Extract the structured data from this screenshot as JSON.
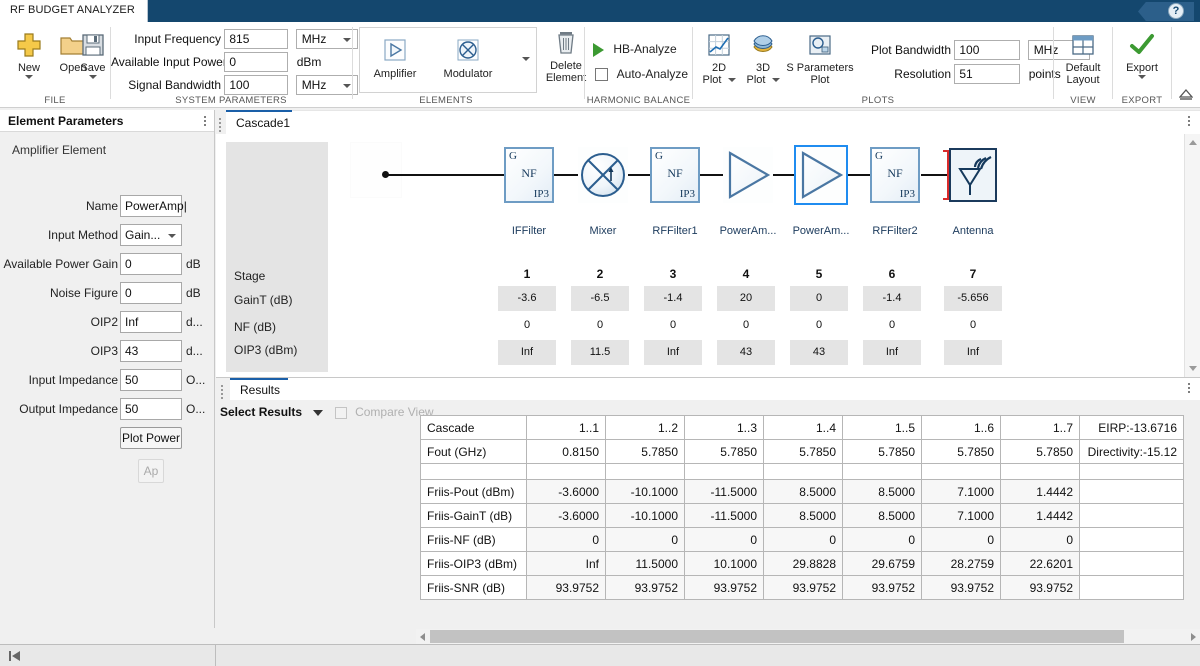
{
  "titlebar": {
    "app_tab": "RF BUDGET ANALYZER",
    "help_icon": "help-question-icon",
    "help_glyph": "?"
  },
  "ribbon": {
    "groups": [
      {
        "id": "file",
        "label": "FILE"
      },
      {
        "id": "system",
        "label": "SYSTEM PARAMETERS"
      },
      {
        "id": "elements",
        "label": "ELEMENTS"
      },
      {
        "id": "harmonic",
        "label": "HARMONIC BALANCE"
      },
      {
        "id": "plots",
        "label": "PLOTS"
      },
      {
        "id": "view",
        "label": "VIEW"
      },
      {
        "id": "export",
        "label": "EXPORT"
      }
    ],
    "file": {
      "new_label": "New",
      "new_icon": "plus-icon",
      "open_label": "Open",
      "open_icon": "folder-icon",
      "save_label": "Save",
      "save_icon": "floppy-disk-icon"
    },
    "system_parameters": {
      "input_frequency_label": "Input Frequency",
      "input_frequency_value": "815",
      "input_frequency_unit": "MHz",
      "available_input_power_label": "Available Input Power",
      "available_input_power_value": "0",
      "available_input_power_unit": "dBm",
      "signal_bandwidth_label": "Signal Bandwidth",
      "signal_bandwidth_value": "100",
      "signal_bandwidth_unit": "MHz"
    },
    "elements": {
      "amplifier_label": "Amplifier",
      "amplifier_icon": "amplifier-triangle-icon",
      "modulator_label": "Modulator",
      "modulator_icon": "modulator-circle-x-icon",
      "more_icon": "chevron-down-icon",
      "delete_element_line1": "Delete",
      "delete_element_line2": "Element",
      "delete_icon": "trash-icon"
    },
    "harmonic_balance": {
      "hb_analyze_label": "HB-Analyze",
      "hb_analyze_icon": "play-triangle-icon",
      "auto_analyze_label": "Auto-Analyze",
      "auto_analyze_checked": false
    },
    "plots": {
      "plot2d_line1": "2D",
      "plot2d_line2": "Plot",
      "plot2d_icon": "line-chart-icon",
      "plot3d_line1": "3D",
      "plot3d_line2": "Plot",
      "plot3d_icon": "surface-3d-icon",
      "sparams_line1": "S Parameters",
      "sparams_line2": "Plot",
      "sparams_icon": "s-parameters-icon",
      "plot_bandwidth_label": "Plot Bandwidth",
      "plot_bandwidth_value": "100",
      "plot_bandwidth_unit": "MHz",
      "resolution_label": "Resolution",
      "resolution_value": "51",
      "resolution_unit": "points"
    },
    "view": {
      "default_layout_line1": "Default",
      "default_layout_line2": "Layout",
      "layout_icon": "grid-layout-icon"
    },
    "export": {
      "export_label": "Export",
      "export_icon": "green-check-icon"
    },
    "collapse_icon": "collapse-ribbon-icon"
  },
  "left_panel": {
    "title": "Element Parameters",
    "overflow_icon": "kebab-menu-icon",
    "section_title": "Amplifier Element",
    "fields": [
      {
        "label": "Name",
        "value": "PowerAmp|",
        "unit": "",
        "type": "text"
      },
      {
        "label": "Input Method",
        "value": "Gain...",
        "unit": "",
        "type": "select"
      },
      {
        "label": "Available Power Gain",
        "value": "0",
        "unit": "dB",
        "type": "text"
      },
      {
        "label": "Noise Figure",
        "value": "0",
        "unit": "dB",
        "type": "text"
      },
      {
        "label": "OIP2",
        "value": "Inf",
        "unit": "d...",
        "type": "text"
      },
      {
        "label": "OIP3",
        "value": "43",
        "unit": "d...",
        "type": "text"
      },
      {
        "label": "Input Impedance",
        "value": "50",
        "unit": "O...",
        "type": "text"
      },
      {
        "label": "Output Impedance",
        "value": "50",
        "unit": "O...",
        "type": "text"
      }
    ],
    "plot_power_label": "Plot Power",
    "apply_label": "Ap"
  },
  "canvas": {
    "tab_label": "Cascade1",
    "grip_icon": "drag-grip-icon",
    "overflow_icon": "kebab-menu-icon",
    "scroll_up_icon": "scroll-up-arrow",
    "scroll_down_icon": "scroll-down-arrow",
    "elements": [
      {
        "name": "IFFilter",
        "kind": "filter",
        "selected": false,
        "g": "G",
        "nf": "NF",
        "ip3": "IP3"
      },
      {
        "name": "Mixer",
        "kind": "mixer",
        "selected": false
      },
      {
        "name": "RFFilter1",
        "kind": "filter",
        "selected": false,
        "g": "G",
        "nf": "NF",
        "ip3": "IP3"
      },
      {
        "name": "PowerAm...",
        "kind": "amplifier",
        "selected": false
      },
      {
        "name": "PowerAm...",
        "kind": "amplifier",
        "selected": true
      },
      {
        "name": "RFFilter2",
        "kind": "filter",
        "selected": false,
        "g": "G",
        "nf": "NF",
        "ip3": "IP3"
      },
      {
        "name": "Antenna",
        "kind": "antenna",
        "selected": false
      }
    ]
  },
  "stage_table": {
    "row_labels": [
      "Stage",
      "GainT (dB)",
      "NF (dB)",
      "OIP3 (dBm)"
    ],
    "stages": [
      "1",
      "2",
      "3",
      "4",
      "5",
      "6",
      "7"
    ],
    "gaint": [
      "-3.6",
      "-6.5",
      "-1.4",
      "20",
      "0",
      "-1.4",
      "-5.656"
    ],
    "nf": [
      "0",
      "0",
      "0",
      "0",
      "0",
      "0",
      "0"
    ],
    "oip3": [
      "Inf",
      "11.5",
      "Inf",
      "43",
      "43",
      "Inf",
      "Inf"
    ]
  },
  "results": {
    "tab_label": "Results",
    "grip_icon": "drag-grip-icon",
    "overflow_icon": "kebab-menu-icon",
    "select_results_label": "Select Results",
    "select_results_icon": "caret-down-icon",
    "compare_view_label": "Compare View",
    "compare_view_checked": false,
    "columns": [
      "1..1",
      "1..2",
      "1..3",
      "1..4",
      "1..5",
      "1..6",
      "1..7"
    ],
    "rows": [
      {
        "label": "Cascade",
        "values": [
          "1..1",
          "1..2",
          "1..3",
          "1..4",
          "1..5",
          "1..6",
          "1..7"
        ],
        "end": "EIRP:-13.6716",
        "shaded": false
      },
      {
        "label": "Fout (GHz)",
        "values": [
          "0.8150",
          "5.7850",
          "5.7850",
          "5.7850",
          "5.7850",
          "5.7850",
          "5.7850"
        ],
        "end": "Directivity:-15.12",
        "shaded": false
      },
      {
        "label": "",
        "values": [
          "",
          "",
          "",
          "",
          "",
          "",
          ""
        ],
        "end": "",
        "shaded": false,
        "gap": true
      },
      {
        "label": "Friis-Pout (dBm)",
        "values": [
          "-3.6000",
          "-10.1000",
          "-11.5000",
          "8.5000",
          "8.5000",
          "7.1000",
          "1.4442"
        ],
        "end": "",
        "shaded": true
      },
      {
        "label": "Friis-GainT (dB)",
        "values": [
          "-3.6000",
          "-10.1000",
          "-11.5000",
          "8.5000",
          "8.5000",
          "7.1000",
          "1.4442"
        ],
        "end": "",
        "shaded": true
      },
      {
        "label": "Friis-NF (dB)",
        "values": [
          "0",
          "0",
          "0",
          "0",
          "0",
          "0",
          "0"
        ],
        "end": "",
        "shaded": true
      },
      {
        "label": "Friis-OIP3 (dBm)",
        "values": [
          "Inf",
          "11.5000",
          "10.1000",
          "29.8828",
          "29.6759",
          "28.2759",
          "22.6201"
        ],
        "end": "",
        "shaded": true
      },
      {
        "label": "Friis-SNR (dB)",
        "values": [
          "93.9752",
          "93.9752",
          "93.9752",
          "93.9752",
          "93.9752",
          "93.9752",
          "93.9752"
        ],
        "end": "",
        "shaded": true
      }
    ],
    "hscroll_left_icon": "scroll-left-arrow",
    "hscroll_right_icon": "scroll-right-arrow"
  },
  "statusbar": {
    "prev_icon": "skip-to-start-icon",
    "prev_glyph": "⏮"
  },
  "colors": {
    "titlebar": "#14476e",
    "accent_tab": "#1a5fa8",
    "selection": "#1f8cf0",
    "element_outline": "#6e9cc4",
    "element_label": "#1b3a5c",
    "red_marker": "#d92b2b",
    "green_check": "#3c9a32",
    "stage_cell": "#e4e4e4"
  }
}
